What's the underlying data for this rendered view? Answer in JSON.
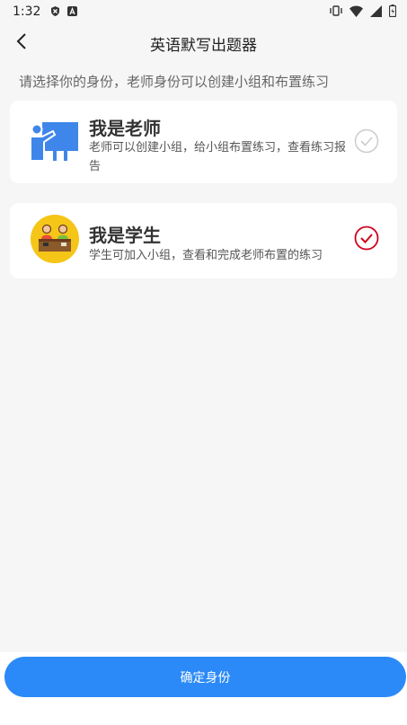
{
  "status_bar": {
    "time": "1:32",
    "left_icons": [
      "shield-icon",
      "a-icon"
    ],
    "right_icons": [
      "vibrate-icon",
      "wifi-icon",
      "signal-icon",
      "battery-icon"
    ]
  },
  "app_bar": {
    "back_icon": "chevron-left-icon",
    "title": "英语默写出题器"
  },
  "hint": "请选择你的身份，老师身份可以创建小组和布置练习",
  "roles": [
    {
      "title": "我是老师",
      "description": "老师可以创建小组，给小组布置练习，查看练习报告",
      "icon": "teacher-icon",
      "selected": false
    },
    {
      "title": "我是学生",
      "description": "学生可加入小组，查看和完成老师布置的练习",
      "icon": "student-icon",
      "selected": true
    }
  ],
  "confirm_button": "确定身份",
  "colors": {
    "primary": "#2b8af7",
    "selected_check": "#d0021b",
    "unselected_check": "#cccccc",
    "teacher_icon": "#3f86ea",
    "student_icon_bg": "#f5c518",
    "background": "#f6f6f6"
  }
}
